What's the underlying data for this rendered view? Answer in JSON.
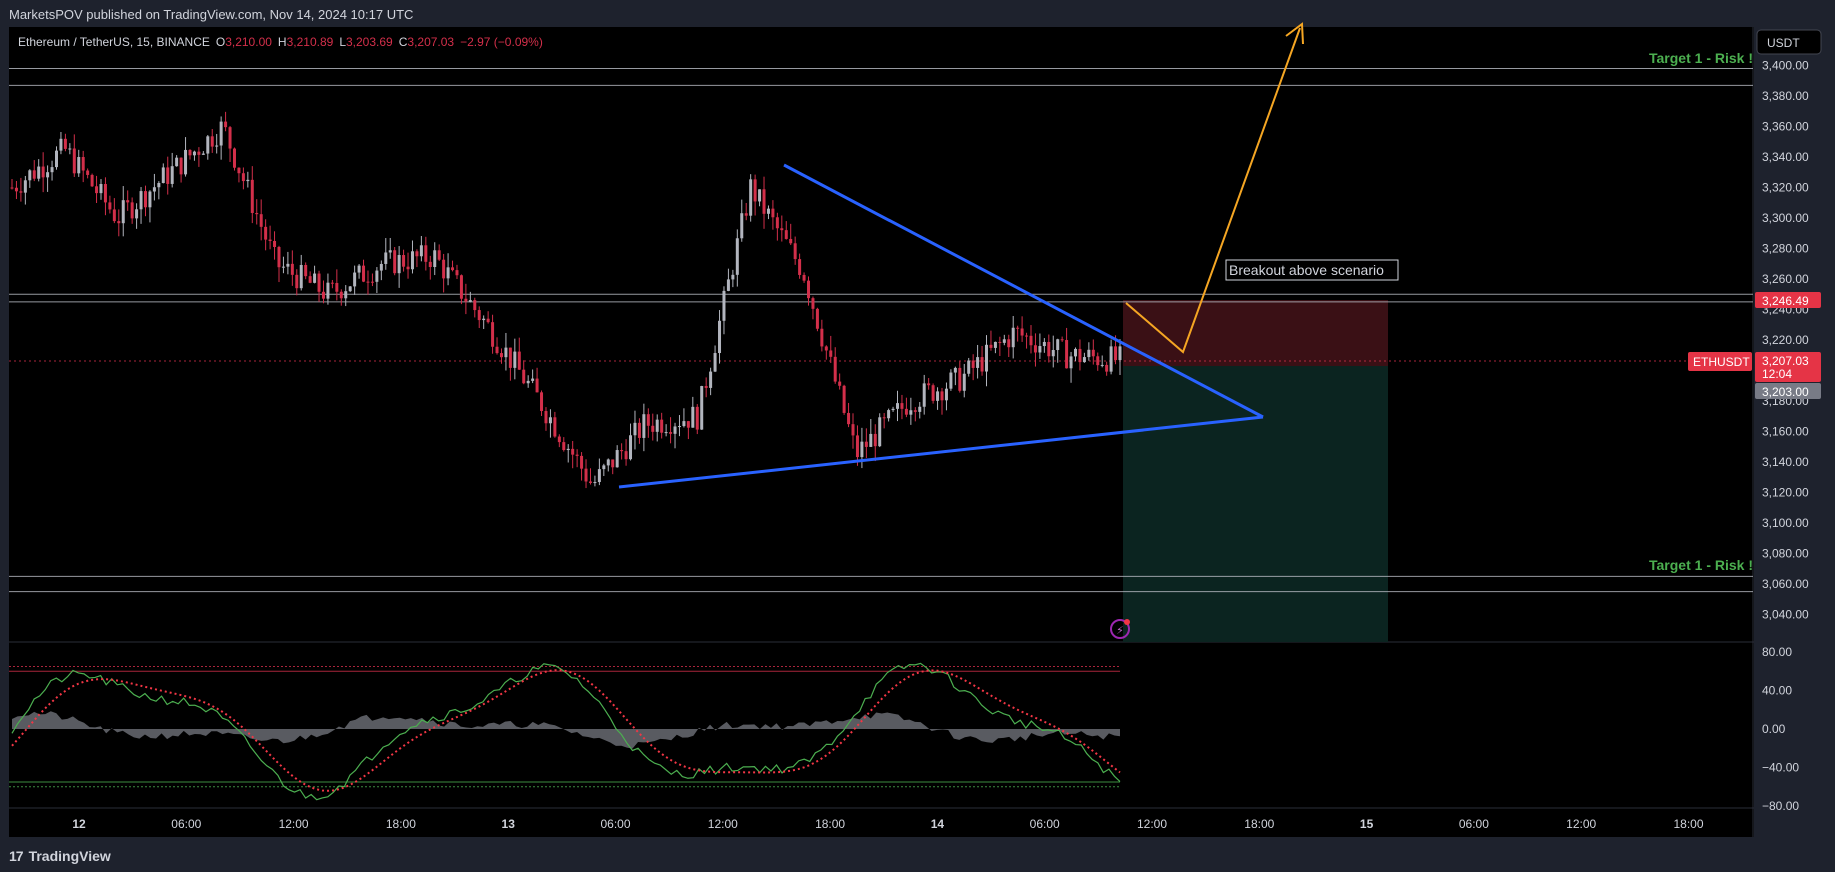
{
  "header": {
    "published": "MarketsPOV published on TradingView.com, Nov 14, 2024 10:17 UTC"
  },
  "symbol_info": {
    "name": "Ethereum / TetherUS, 15, BINANCE",
    "o_label": "O",
    "o_value": "3,210.00",
    "h_label": "H",
    "h_value": "3,210.89",
    "l_label": "L",
    "l_value": "3,203.69",
    "c_label": "C",
    "c_value": "3,207.03",
    "change": "−2.97 (−0.09%)"
  },
  "price_axis": {
    "currency": "USDT",
    "ticks": [
      "3,400.00",
      "3,380.00",
      "3,360.00",
      "3,340.00",
      "3,320.00",
      "3,300.00",
      "3,280.00",
      "3,260.00",
      "3,240.00",
      "3,220.00",
      "3,200.00",
      "3,180.00",
      "3,160.00",
      "3,140.00",
      "3,120.00",
      "3,100.00",
      "3,080.00",
      "3,060.00",
      "3,040.00"
    ]
  },
  "price_labels": {
    "target_price": "3,246.49",
    "symbol": "ETHUSDT",
    "last_price": "3,207.03",
    "countdown": "12:04",
    "stop_price": "3,203.00"
  },
  "annotations": {
    "target_upper": "Target 1 - Risk !",
    "target_lower": "Target 1 - Risk !",
    "scenario": "Breakout above scenario"
  },
  "time_axis": {
    "ticks": [
      "12",
      "06:00",
      "12:00",
      "18:00",
      "13",
      "06:00",
      "12:00",
      "18:00",
      "14",
      "06:00",
      "12:00",
      "18:00",
      "15",
      "06:00",
      "12:00",
      "18:00"
    ]
  },
  "osc_axis": {
    "ticks": [
      "80.00",
      "40.00",
      "0.00",
      "−40.00",
      "−80.00"
    ]
  },
  "footer": {
    "brand": "TradingView"
  },
  "colors": {
    "background": "#000000",
    "up_candle": "#b2b5be",
    "down_candle": "#d32f4a",
    "trendline": "#2962ff",
    "arrow": "#f5a623",
    "target_text": "#4caf50",
    "risk_zone": "#3a1015",
    "reward_zone": "#0b2420",
    "price_label": "#e53446"
  },
  "chart_data": [
    {
      "type": "candlestick",
      "title": "Ethereum / TetherUS, 15, BINANCE",
      "x": [
        "Nov 11 21:00",
        "Nov 12 00:00",
        "Nov 12 03:00",
        "Nov 12 06:00",
        "Nov 12 09:00",
        "Nov 12 12:00",
        "Nov 12 15:00",
        "Nov 12 18:00",
        "Nov 12 21:00",
        "Nov 13 00:00",
        "Nov 13 03:00",
        "Nov 13 06:00",
        "Nov 13 09:00",
        "Nov 13 12:00",
        "Nov 13 15:00",
        "Nov 13 18:00",
        "Nov 13 21:00",
        "Nov 14 00:00",
        "Nov 14 03:00",
        "Nov 14 06:00",
        "Nov 14 09:00",
        "Nov 14 10:15"
      ],
      "series": [
        {
          "values": [
            3320,
            3345,
            3300,
            3330,
            3360,
            3270,
            3250,
            3270,
            3275,
            3230,
            3180,
            3125,
            3165,
            3170,
            3320,
            3265,
            3145,
            3180,
            3195,
            3225,
            3210,
            3207.03
          ]
        }
      ],
      "ylim": [
        3030,
        3410
      ],
      "horizontal_levels": [
        3398,
        3387,
        3250,
        3245,
        3065,
        3055
      ],
      "trendlines": [
        {
          "from": [
            "Nov 13 16:00",
            3335
          ],
          "to": [
            "Nov 14 17:00",
            3168
          ]
        },
        {
          "from": [
            "Nov 13 06:00",
            3122
          ],
          "to": [
            "Nov 14 17:00",
            3168
          ]
        }
      ],
      "position": {
        "entry": 3207.03,
        "target": 3246.49,
        "stop": 3030
      }
    },
    {
      "type": "line",
      "ylim": [
        -85,
        85
      ],
      "levels": [
        60,
        -60,
        -55,
        65
      ]
    }
  ]
}
